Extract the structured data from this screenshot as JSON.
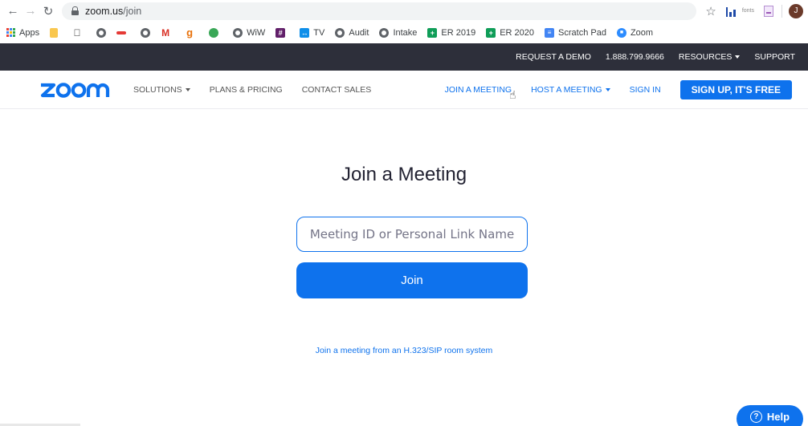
{
  "browser": {
    "url_host": "zoom.us",
    "url_path": "/join",
    "profile_initial": "J",
    "ext_fonts_label": "fonts"
  },
  "bookmarks": [
    {
      "label": "Apps",
      "icon": "apps-grid-icon"
    },
    {
      "label": "",
      "icon": "folder-icon"
    },
    {
      "label": "",
      "icon": "apple-icon"
    },
    {
      "label": "",
      "icon": "globe-icon"
    },
    {
      "label": "",
      "icon": "red-bar-icon"
    },
    {
      "label": "",
      "icon": "globe-icon"
    },
    {
      "label": "",
      "icon": "gmail-icon"
    },
    {
      "label": "",
      "icon": "g-icon"
    },
    {
      "label": "",
      "icon": "green-blob-icon"
    },
    {
      "label": "WiW",
      "icon": "globe-icon"
    },
    {
      "label": "",
      "icon": "slack-icon"
    },
    {
      "label": "TV",
      "icon": "teamviewer-icon"
    },
    {
      "label": "Audit",
      "icon": "globe-icon"
    },
    {
      "label": "Intake",
      "icon": "globe-icon"
    },
    {
      "label": "ER 2019",
      "icon": "sheets-icon"
    },
    {
      "label": "ER 2020",
      "icon": "sheets-icon"
    },
    {
      "label": "Scratch Pad",
      "icon": "docs-icon"
    },
    {
      "label": "Zoom",
      "icon": "zoom-icon"
    }
  ],
  "topbar": {
    "request_demo": "REQUEST A DEMO",
    "phone": "1.888.799.9666",
    "resources": "RESOURCES",
    "support": "SUPPORT"
  },
  "nav": {
    "solutions": "SOLUTIONS",
    "plans": "PLANS & PRICING",
    "contact": "CONTACT SALES",
    "join": "JOIN A MEETING",
    "host": "HOST A MEETING",
    "sign_in": "SIGN IN",
    "signup": "SIGN UP, IT'S FREE"
  },
  "main": {
    "title": "Join a Meeting",
    "input_placeholder": "Meeting ID or Personal Link Name",
    "input_value": "",
    "join_label": "Join",
    "sip_link": "Join a meeting from an H.323/SIP room system"
  },
  "help": {
    "label": "Help"
  },
  "colors": {
    "brand_blue": "#0e72ed",
    "topbar_bg": "#2d2f3a"
  }
}
